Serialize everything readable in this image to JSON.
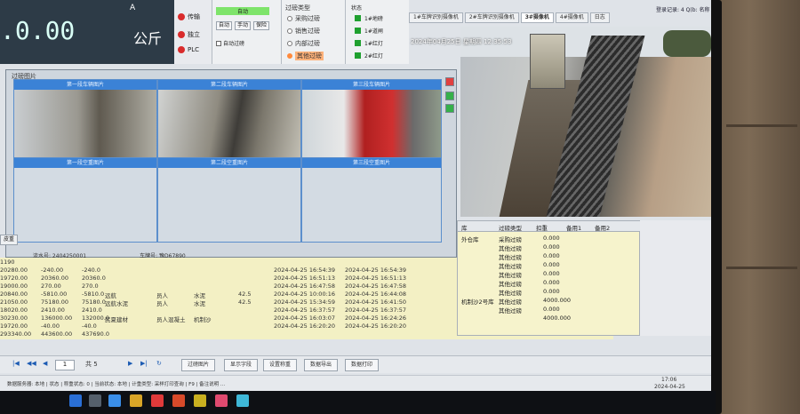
{
  "weight": {
    "value": ".0.00",
    "unit": "公斤",
    "a_mark": "A"
  },
  "status_lights": [
    "传输",
    "独立",
    "PLC"
  ],
  "controls": {
    "auto_label": "自动",
    "buttons": [
      "自动",
      "手动",
      "保险"
    ],
    "checkbox_label": "自动过磅"
  },
  "weigh_type": {
    "title": "过磅类型",
    "options": [
      "采购过磅",
      "销售过磅",
      "内部过磅",
      "其他过磅"
    ],
    "selected_index": 3
  },
  "lights": {
    "title": "状态",
    "items": [
      "1#地磅",
      "1#道闸",
      "1#红灯",
      "2#红灯"
    ]
  },
  "tabs": [
    "1#车牌识别摄像机",
    "2#车牌识别摄像机",
    "3#摄像机",
    "4#摄像机",
    "日志"
  ],
  "active_tab_index": 2,
  "login_info": "登录记录: 4 Q(b: 名称",
  "camera": {
    "timestamp": "2024年04月25日 星期四 12:35:53"
  },
  "photo_dialog": {
    "title": "过磅图片",
    "captions_top": [
      "第一段车辆图片",
      "第二段车辆图片",
      "第三段车辆图片"
    ],
    "captions_bottom": [
      "第一段空重图片",
      "第二段空重图片",
      "第三段空重图片"
    ],
    "footer_left": "流水号: 2404250001",
    "footer_right": "车牌号: 豫D67890"
  },
  "grid_rows": [
    [
      "1190",
      "",
      "",
      "",
      "",
      "",
      "",
      "",
      "",
      ""
    ],
    [
      "20280.00",
      "-240.00",
      "-240.0",
      "",
      "",
      "",
      "",
      "2024-04-25 16:54:39",
      "2024-04-25 16:54:39",
      ""
    ],
    [
      "19720.00",
      "20360.00",
      "20360.0",
      "",
      "",
      "",
      "",
      "2024-04-25 16:51:13",
      "2024-04-25 16:51:13",
      ""
    ],
    [
      "19000.00",
      "270.00",
      "270.0",
      "",
      "",
      "",
      "",
      "2024-04-25 16:47:58",
      "2024-04-25 16:47:58",
      ""
    ],
    [
      "20840.00",
      "-5810.00",
      "-5810.0",
      "远航",
      "员人",
      "水泥",
      "42.5",
      "2024-04-25 10:00:16",
      "2024-04-25 16:44:08",
      ""
    ],
    [
      "21050.00",
      "75180.00",
      "75180.0",
      "远航水泥",
      "员人",
      "水泥",
      "42.5",
      "2024-04-25 15:34:59",
      "2024-04-25 16:41:50",
      ""
    ],
    [
      "18020.00",
      "2410.00",
      "2410.0",
      "",
      "",
      "",
      "",
      "2024-04-25 16:37:57",
      "2024-04-25 16:37:57",
      ""
    ],
    [
      "30230.00",
      "136000.00",
      "132000.0",
      "民夏建材",
      "员人混凝土",
      "机制沙",
      "",
      "2024-04-25 16:03:07",
      "2024-04-25 16:24:26",
      ""
    ],
    [
      "19720.00",
      "-40.00",
      "-40.0",
      "",
      "",
      "",
      "",
      "2024-04-25 16:20:20",
      "2024-04-25 16:20:20",
      ""
    ],
    [
      "293340.00",
      "443600.00",
      "437690.0",
      "",
      "",
      "",
      "",
      "",
      "",
      ""
    ]
  ],
  "right_table": {
    "headers": [
      "库",
      "过磅类型",
      "扣重",
      "备用1",
      "备用2"
    ],
    "rows": [
      [
        "外仓库",
        "采购过磅",
        "0.000"
      ],
      [
        "",
        "其他过磅",
        "0.000"
      ],
      [
        "",
        "其他过磅",
        "0.000"
      ],
      [
        "",
        "其他过磅",
        "0.000"
      ],
      [
        "",
        "其他过磅",
        "0.000"
      ],
      [
        "",
        "其他过磅",
        "0.000"
      ],
      [
        "",
        "其他过磅",
        "0.000"
      ],
      [
        "机制沙2号库",
        "其他过磅",
        "4000.000"
      ],
      [
        "",
        "其他过磅",
        "0.000"
      ],
      [
        "",
        "",
        "4000.000"
      ]
    ]
  },
  "left_stub": "皮重",
  "pager": {
    "page_input": "1",
    "total": "共 5",
    "buttons": [
      "过磅图片",
      "显示字段",
      "设置称重",
      "数据导出",
      "数据打印"
    ]
  },
  "statusbar": "数据服务器: 本地 | 状态 | 称重状态: 0 | 当前状态: 本地 | 计重类型: 采样打印查询 | F9 | 备注说明 ...",
  "clock": {
    "time": "17:06",
    "date": "2024-04-25"
  }
}
